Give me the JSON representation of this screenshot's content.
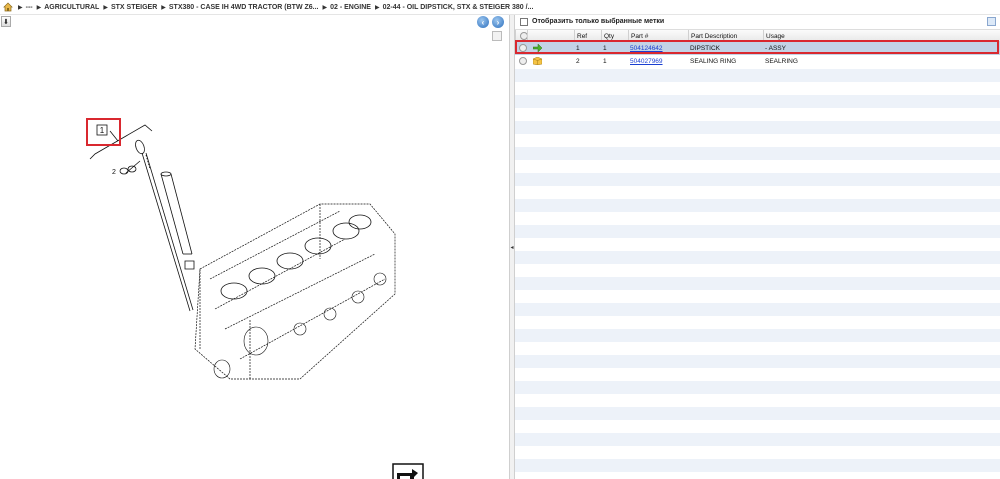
{
  "breadcrumb": {
    "items": [
      "---",
      "AGRICULTURAL",
      "STX STEIGER",
      "STX380 - CASE IH 4WD TRACTOR (BTW Z6...",
      "02 - ENGINE",
      "02-44 - OIL DIPSTICK, STX & STEIGER 380 /..."
    ]
  },
  "diagram": {
    "callout_1": "1",
    "callout_2": "2"
  },
  "filter": {
    "label": "Отобразить только выбранные метки"
  },
  "table": {
    "headers": {
      "ref": "Ref",
      "qty": "Qty",
      "part": "Part #",
      "desc": "Part Description",
      "usage": "Usage"
    },
    "rows": [
      {
        "ref": "1",
        "qty": "1",
        "part": "504124642",
        "desc": "DIPSTICK",
        "usage": "- ASSY",
        "status": "green-arrow-icon"
      },
      {
        "ref": "2",
        "qty": "1",
        "part": "504027969",
        "desc": "SEALING RING",
        "usage": "SEALRING",
        "status": "box-icon"
      }
    ]
  },
  "colors": {
    "selected_row": "#c3d3e6",
    "highlight_outline": "#d9282f",
    "link": "#1a3fd1"
  }
}
